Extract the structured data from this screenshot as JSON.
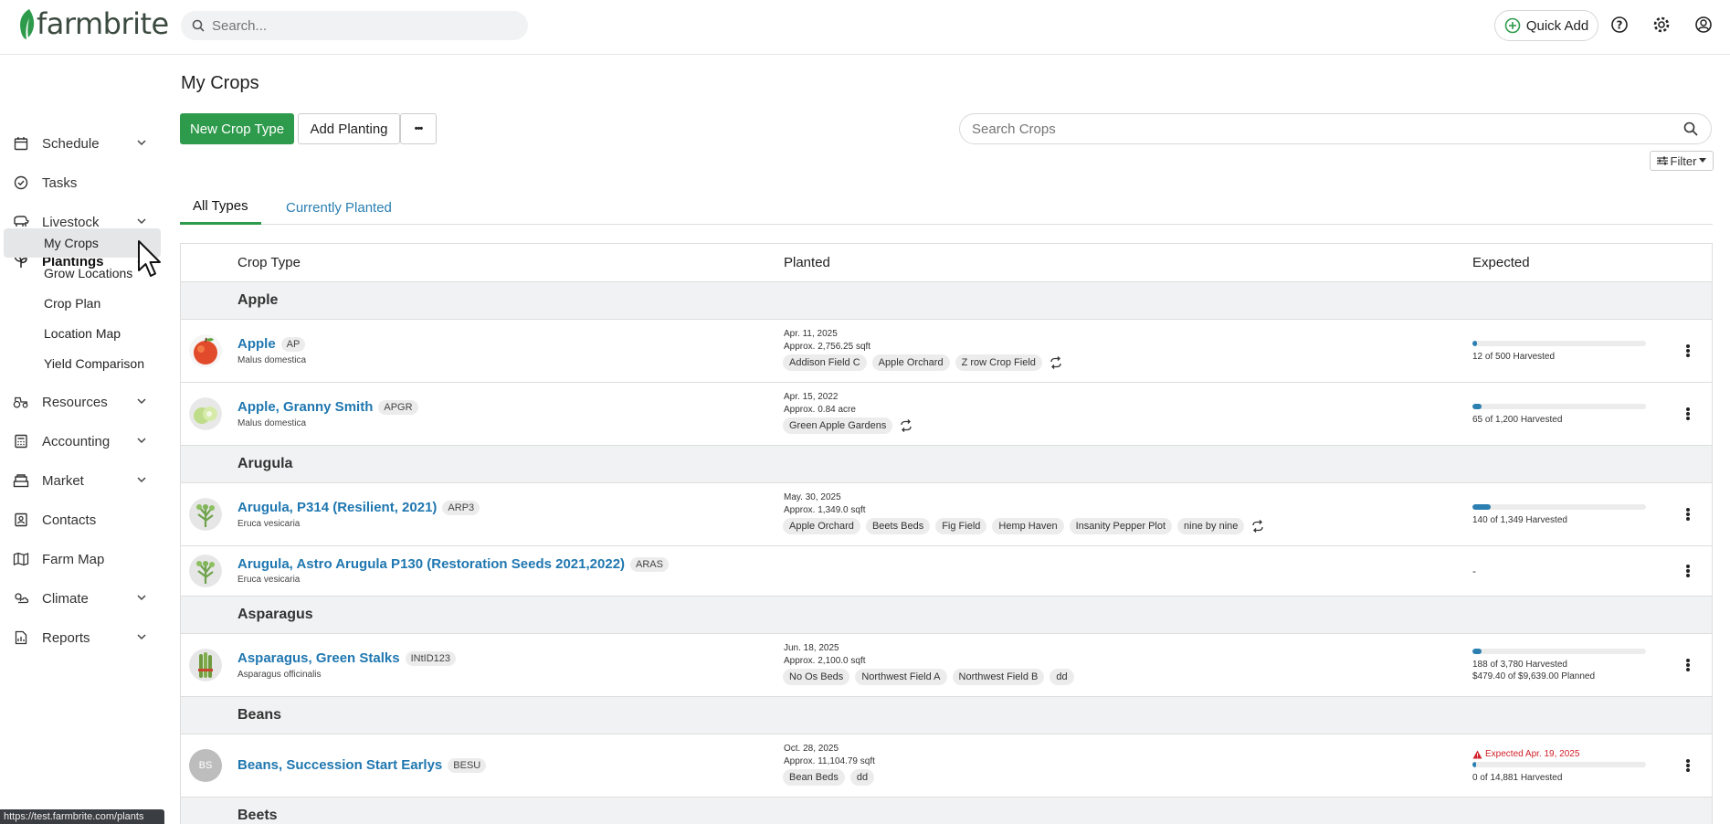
{
  "brand": {
    "name": "farmbrite",
    "accent": "#2e9b4c",
    "link": "#1f77b0"
  },
  "header": {
    "search_placeholder": "Search...",
    "quick_add_label": "Quick Add",
    "icons": [
      "help-icon",
      "gear-icon",
      "user-icon"
    ]
  },
  "sidebar": {
    "items": [
      {
        "label": "Schedule",
        "icon": "calendar-icon",
        "expandable": true
      },
      {
        "label": "Tasks",
        "icon": "check-circle-icon",
        "expandable": false
      },
      {
        "label": "Livestock",
        "icon": "livestock-icon",
        "expandable": true
      },
      {
        "label": "Plantings",
        "icon": "sprout-icon",
        "expandable": true,
        "expanded": true
      },
      {
        "label": "Resources",
        "icon": "tractor-icon",
        "expandable": true
      },
      {
        "label": "Accounting",
        "icon": "calculator-icon",
        "expandable": true
      },
      {
        "label": "Market",
        "icon": "market-icon",
        "expandable": true
      },
      {
        "label": "Contacts",
        "icon": "contacts-icon",
        "expandable": false
      },
      {
        "label": "Farm Map",
        "icon": "map-icon",
        "expandable": false
      },
      {
        "label": "Climate",
        "icon": "climate-icon",
        "expandable": true
      },
      {
        "label": "Reports",
        "icon": "report-icon",
        "expandable": true
      }
    ],
    "plantings_sub": [
      {
        "label": "My Crops",
        "selected": true
      },
      {
        "label": "Grow Locations"
      },
      {
        "label": "Crop Plan"
      },
      {
        "label": "Location Map"
      },
      {
        "label": "Yield Comparison"
      }
    ]
  },
  "main": {
    "title": "My Crops",
    "new_crop_label": "New Crop Type",
    "add_planting_label": "Add Planting",
    "more_label": "•••",
    "search_placeholder": "Search Crops",
    "filter_label": "Filter",
    "tabs": [
      {
        "label": "All Types",
        "active": true
      },
      {
        "label": "Currently Planted",
        "active": false
      }
    ],
    "columns": {
      "crop_type": "Crop Type",
      "planted": "Planted",
      "expected": "Expected"
    },
    "groups": [
      {
        "name": "Apple",
        "rows": [
          {
            "name": "Apple",
            "code": "AP",
            "sci": "Malus domestica",
            "thumb": "apple",
            "date": "Apr. 11, 2025",
            "area": "Approx. 2,756.25 sqft",
            "locations": [
              "Addison Field C",
              "Apple Orchard",
              "Z row Crop Field"
            ],
            "repeat": true,
            "progress": 0.024,
            "harvested": "12 of 500 Harvested"
          },
          {
            "name": "Apple, Granny Smith",
            "code": "APGR",
            "sci": "Malus domestica",
            "thumb": "granny",
            "date": "Apr. 15, 2022",
            "area": "Approx. 0.84 acre",
            "locations": [
              "Green Apple Gardens"
            ],
            "repeat": true,
            "progress": 0.054,
            "harvested": "65 of 1,200 Harvested"
          }
        ]
      },
      {
        "name": "Arugula",
        "rows": [
          {
            "name": "Arugula, P314 (Resilient, 2021)",
            "code": "ARP3",
            "sci": "Eruca vesicaria",
            "thumb": "arugula",
            "date": "May. 30, 2025",
            "area": "Approx. 1,349.0 sqft",
            "locations": [
              "Apple Orchard",
              "Beets Beds",
              "Fig Field",
              "Hemp Haven",
              "Insanity Pepper Plot",
              "nine by nine"
            ],
            "repeat": true,
            "progress": 0.104,
            "harvested": "140 of 1,349 Harvested"
          },
          {
            "name": "Arugula, Astro Arugula P130 (Restoration Seeds 2021,2022)",
            "code": "ARAS",
            "sci": "Eruca vesicaria",
            "thumb": "arugula",
            "date": "",
            "area": "",
            "locations": [],
            "repeat": false,
            "progress": null,
            "harvested": "-"
          }
        ]
      },
      {
        "name": "Asparagus",
        "rows": [
          {
            "name": "Asparagus, Green Stalks",
            "code": "INtID123",
            "sci": "Asparagus officinalis",
            "thumb": "asparagus",
            "date": "Jun. 18, 2025",
            "area": "Approx. 2,100.0 sqft",
            "locations": [
              "No Os Beds",
              "Northwest Field A",
              "Northwest Field B",
              "dd"
            ],
            "repeat": false,
            "progress": 0.05,
            "harvested": "188 of 3,780 Harvested",
            "planned": "$479.40 of $9,639.00 Planned"
          }
        ]
      },
      {
        "name": "Beans",
        "rows": [
          {
            "name": "Beans, Succession Start Earlys",
            "code": "BESU",
            "sci": "",
            "thumb": "initials",
            "initials": "BS",
            "date": "Oct. 28, 2025",
            "area": "Approx. 11,104.79 sqft",
            "locations": [
              "Bean Beds",
              "dd"
            ],
            "repeat": false,
            "progress": 0,
            "warning": "Expected Apr. 19, 2025",
            "harvested": "0 of 14,881 Harvested"
          }
        ]
      },
      {
        "name": "Beets",
        "rows": []
      }
    ]
  },
  "status_url": "https://test.farmbrite.com/plants"
}
